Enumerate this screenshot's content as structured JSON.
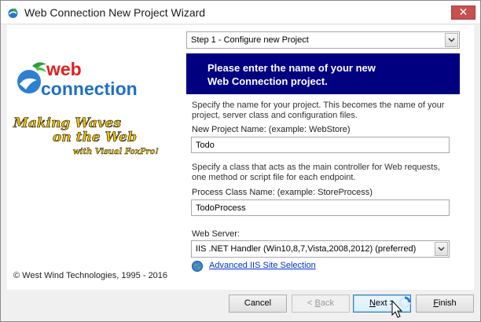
{
  "window": {
    "title": "Web Connection New Project Wizard"
  },
  "step_select": {
    "value": "Step 1 - Configure new Project"
  },
  "banner": {
    "line1": "Please enter the name of your new",
    "line2": "Web Connection project."
  },
  "project_name": {
    "description_line1": "Specify the name for your project. This becomes the name of your",
    "description_line2": "project, server class and configuration files.",
    "label": "New Project Name:   (example: WebStore)",
    "value": "Todo"
  },
  "process_class": {
    "description_line1": "Specify a  class that acts as the  main controller for Web requests,",
    "description_line2": "one method or script file for each endpoint.",
    "label": "Process Class Name:   (example: StoreProcess)",
    "value": "TodoProcess"
  },
  "web_server": {
    "label": "Web Server:",
    "value": "IIS .NET Handler (Win10,8,7,Vista,2008,2012) (preferred)"
  },
  "advanced_link": {
    "label": "Advanced  IIS Site Selection"
  },
  "logo": {
    "line1": "web",
    "line2": "connection"
  },
  "tagline": {
    "line1": "Making Waves",
    "line2": "on the Web",
    "line3": "with Visual FoxPro!"
  },
  "copyright": "© West Wind Technologies, 1995 - 2016",
  "buttons": {
    "cancel": "Cancel",
    "back_arrow": "< ",
    "back_key": "B",
    "back_rest": "ack",
    "next_key": "N",
    "next_rest": "ext >",
    "finish_key": "F",
    "finish_rest": "inish"
  },
  "colors": {
    "banner_bg": "#000080",
    "logo_red": "#e02020",
    "logo_blue": "#1f6fc4",
    "tagline_yellow": "#f5c400",
    "link_blue": "#0033cc"
  }
}
